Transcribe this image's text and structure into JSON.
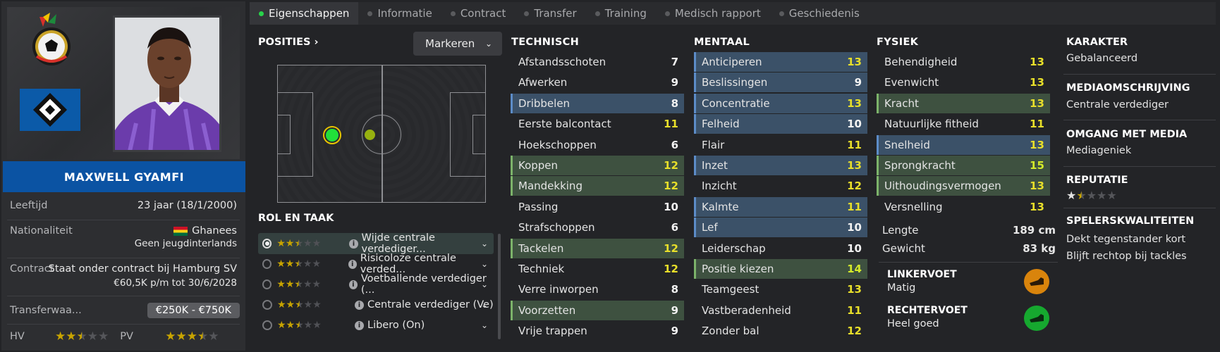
{
  "tabs": [
    {
      "label": "Eigenschappen",
      "active": true
    },
    {
      "label": "Informatie"
    },
    {
      "label": "Contract"
    },
    {
      "label": "Transfer"
    },
    {
      "label": "Training"
    },
    {
      "label": "Medisch rapport"
    },
    {
      "label": "Geschiedenis"
    }
  ],
  "player": {
    "name": "MAXWELL GYAMFI",
    "age_label": "Leeftijd",
    "age_value": "23 jaar (18/1/2000)",
    "nat_label": "Nationaliteit",
    "nat_value": "Ghanees",
    "nat_sub": "Geen jeugdinterlands",
    "contract_label": "Contract",
    "contract_value": "Staat onder contract bij Hamburg SV",
    "contract_sub": "€60,5K p/m tot 30/6/2028",
    "transfer_label": "Transferwaa...",
    "transfer_value": "€250K - €750K",
    "hv_label": "HV",
    "hv_stars": 2.5,
    "pv_label": "PV",
    "pv_stars": 3.5
  },
  "positions": {
    "title": "POSITIES",
    "mark_label": "Markeren"
  },
  "roles": {
    "title": "ROL EN TAAK",
    "items": [
      {
        "label": "Wijde centrale verdediger...",
        "stars": 2.5,
        "selected": true
      },
      {
        "label": "Risicoloze centrale verded...",
        "stars": 2.5
      },
      {
        "label": "Voetballende verdediger (...",
        "stars": 2.5
      },
      {
        "label": "Centrale verdediger (Ve)",
        "stars": 2.5
      },
      {
        "label": "Libero (On)",
        "stars": 2.5
      }
    ]
  },
  "technisch": {
    "title": "TECHNISCH",
    "rows": [
      {
        "name": "Afstandsschoten",
        "value": 7
      },
      {
        "name": "Afwerken",
        "value": 9
      },
      {
        "name": "Dribbelen",
        "value": 8,
        "hl": "blue"
      },
      {
        "name": "Eerste balcontact",
        "value": 11
      },
      {
        "name": "Hoekschoppen",
        "value": 6
      },
      {
        "name": "Koppen",
        "value": 12,
        "hl": "green"
      },
      {
        "name": "Mandekking",
        "value": 12,
        "hl": "green"
      },
      {
        "name": "Passing",
        "value": 10
      },
      {
        "name": "Strafschoppen",
        "value": 6
      },
      {
        "name": "Tackelen",
        "value": 12,
        "hl": "green"
      },
      {
        "name": "Techniek",
        "value": 12
      },
      {
        "name": "Verre inworpen",
        "value": 8
      },
      {
        "name": "Voorzetten",
        "value": 9,
        "hl": "green"
      },
      {
        "name": "Vrije trappen",
        "value": 9
      }
    ]
  },
  "mentaal": {
    "title": "MENTAAL",
    "rows": [
      {
        "name": "Anticiperen",
        "value": 13,
        "hl": "blue"
      },
      {
        "name": "Beslissingen",
        "value": 9,
        "hl": "blue"
      },
      {
        "name": "Concentratie",
        "value": 13,
        "hl": "blue"
      },
      {
        "name": "Felheid",
        "value": 10,
        "hl": "blue"
      },
      {
        "name": "Flair",
        "value": 11
      },
      {
        "name": "Inzet",
        "value": 13,
        "hl": "blue"
      },
      {
        "name": "Inzicht",
        "value": 12
      },
      {
        "name": "Kalmte",
        "value": 11,
        "hl": "blue"
      },
      {
        "name": "Lef",
        "value": 10,
        "hl": "blue"
      },
      {
        "name": "Leiderschap",
        "value": 10
      },
      {
        "name": "Positie kiezen",
        "value": 14,
        "hl": "green"
      },
      {
        "name": "Teamgeest",
        "value": 13
      },
      {
        "name": "Vastberadenheid",
        "value": 11
      },
      {
        "name": "Zonder bal",
        "value": 12
      }
    ]
  },
  "fysiek": {
    "title": "FYSIEK",
    "rows": [
      {
        "name": "Behendigheid",
        "value": 13
      },
      {
        "name": "Evenwicht",
        "value": 13
      },
      {
        "name": "Kracht",
        "value": 13,
        "hl": "green"
      },
      {
        "name": "Natuurlijke fitheid",
        "value": 11
      },
      {
        "name": "Snelheid",
        "value": 13,
        "hl": "blue"
      },
      {
        "name": "Sprongkracht",
        "value": 15,
        "hl": "green"
      },
      {
        "name": "Uithoudingsvermogen",
        "value": 13,
        "hl": "green"
      },
      {
        "name": "Versnelling",
        "value": 13
      }
    ],
    "lengte_label": "Lengte",
    "lengte_value": "189 cm",
    "gewicht_label": "Gewicht",
    "gewicht_value": "83 kg",
    "linkervoet_label": "LINKERVOET",
    "linkervoet_value": "Matig",
    "rechtervoet_label": "RECHTERVOET",
    "rechtervoet_value": "Heel goed"
  },
  "info": {
    "karakter_label": "KARAKTER",
    "karakter_value": "Gebalanceerd",
    "media_label": "MEDIAOMSCHRIJVING",
    "media_value": "Centrale verdediger",
    "omgang_label": "OMGANG MET MEDIA",
    "omgang_value": "Mediageniek",
    "reputatie_label": "REPUTATIE",
    "reputatie_stars": 1.5,
    "kwaliteiten_label": "SPELERSKWALITEITEN",
    "kwaliteiten": [
      "Dekt tegenstander kort",
      "Blijft rechtop bij tackles"
    ]
  },
  "colors": {
    "yellow_value": "#e8df2a",
    "blue_row": "#3b5168",
    "green_row": "#3e5140",
    "name_bar": "#0b53a3",
    "left_foot": "#d9840c",
    "right_foot": "#16a82f"
  }
}
